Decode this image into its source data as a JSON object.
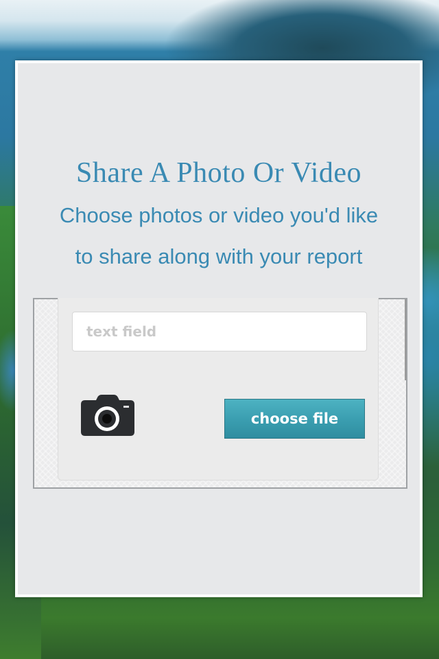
{
  "screen": {
    "title": "Share A Photo Or Video",
    "subtitle_line1": "Choose photos or video you'd like",
    "subtitle_line2": "to share along with your report"
  },
  "form": {
    "text_field_placeholder": "text field",
    "text_field_value": "",
    "choose_file_label": "choose file",
    "camera_icon": "camera-icon"
  },
  "colors": {
    "accent_text": "#3a8ab3",
    "button": "#3b9fb1",
    "panel": "#e7e8ea"
  }
}
